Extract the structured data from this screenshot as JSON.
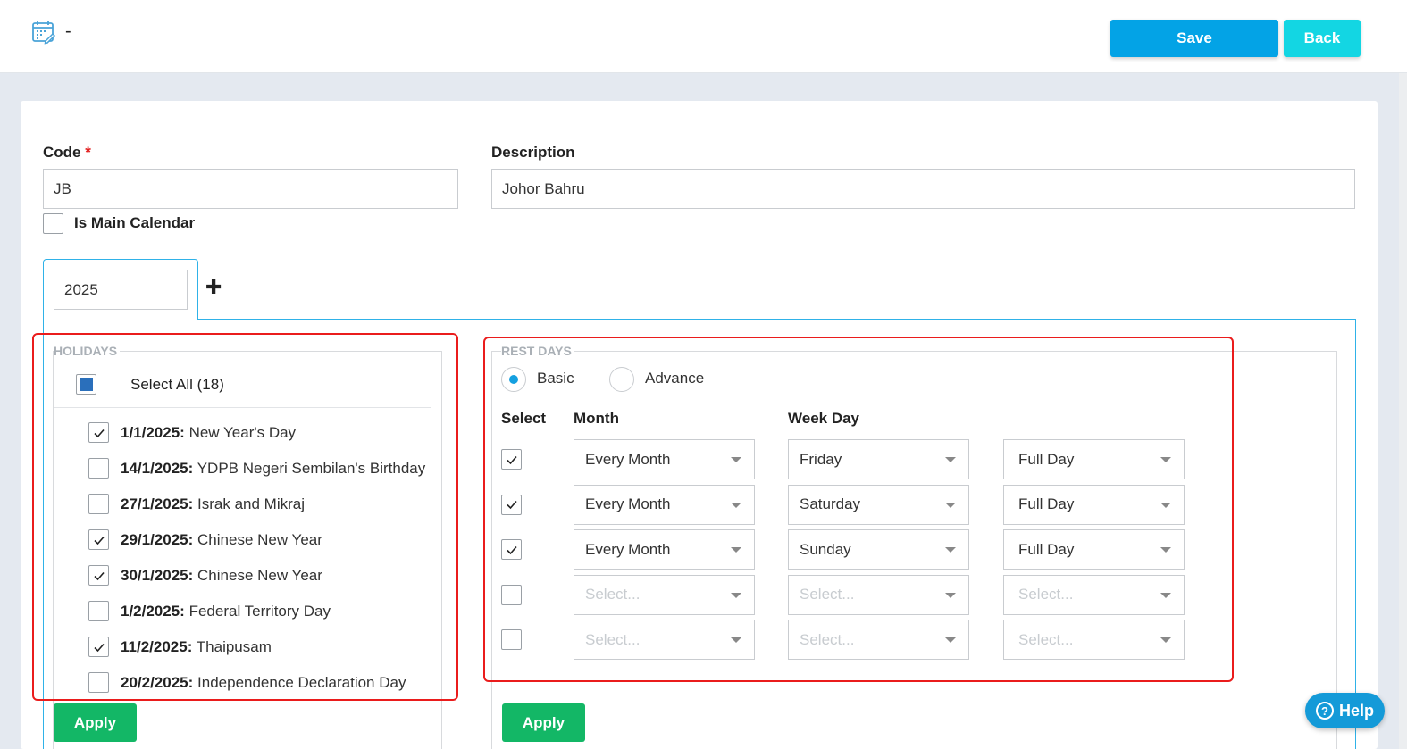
{
  "header": {
    "title": "-",
    "icon": "calendar-edit-icon",
    "save_label": "Save",
    "back_label": "Back"
  },
  "form": {
    "code_label": "Code",
    "code_required": "*",
    "code_value": "JB",
    "description_label": "Description",
    "description_value": "Johor Bahru",
    "main_calendar_label": "Is Main Calendar",
    "main_calendar_checked": false
  },
  "year_tab": {
    "value": "2025",
    "add_icon": "plus-icon"
  },
  "holidays": {
    "legend": "HOLIDAYS",
    "select_all_label": "Select All (18)",
    "items": [
      {
        "date": "1/1/2025:",
        "name": "New Year's Day",
        "checked": true
      },
      {
        "date": "14/1/2025:",
        "name": "YDPB Negeri Sembilan's Birthday",
        "checked": false
      },
      {
        "date": "27/1/2025:",
        "name": "Israk and Mikraj",
        "checked": false
      },
      {
        "date": "29/1/2025:",
        "name": "Chinese New Year",
        "checked": true
      },
      {
        "date": "30/1/2025:",
        "name": "Chinese New Year",
        "checked": true
      },
      {
        "date": "1/2/2025:",
        "name": "Federal Territory Day",
        "checked": false
      },
      {
        "date": "11/2/2025:",
        "name": "Thaipusam",
        "checked": true
      },
      {
        "date": "20/2/2025:",
        "name": "Independence Declaration Day",
        "checked": false
      }
    ],
    "apply_label": "Apply"
  },
  "rest_days": {
    "legend": "REST DAYS",
    "mode_basic": "Basic",
    "mode_advance": "Advance",
    "selected_mode": "Basic",
    "col_select": "Select",
    "col_month": "Month",
    "col_weekday": "Week Day",
    "placeholder": "Select...",
    "rows": [
      {
        "checked": true,
        "month": "Every Month",
        "weekday": "Friday",
        "duration": "Full Day"
      },
      {
        "checked": true,
        "month": "Every Month",
        "weekday": "Saturday",
        "duration": "Full Day"
      },
      {
        "checked": true,
        "month": "Every Month",
        "weekday": "Sunday",
        "duration": "Full Day"
      },
      {
        "checked": false,
        "month": "Select...",
        "weekday": "Select...",
        "duration": "Select..."
      },
      {
        "checked": false,
        "month": "Select...",
        "weekday": "Select...",
        "duration": "Select..."
      }
    ],
    "apply_label": "Apply"
  },
  "help_label": "Help",
  "colors": {
    "save": "#03a3e6",
    "back": "#13d6e3",
    "apply": "#13b766",
    "highlight": "#ea1c1c",
    "tab_border": "#2fb2e8"
  }
}
